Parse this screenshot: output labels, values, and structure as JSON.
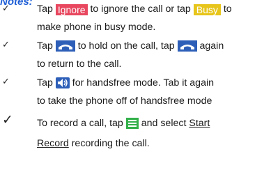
{
  "heading": "Notes:",
  "items": [
    {
      "line1": {
        "pre": "Tap",
        "btn1": "Ignore",
        "mid": "to ignore the call or tap",
        "btn2": "Busy",
        "post": "to"
      },
      "line2": "make phone in busy mode."
    },
    {
      "line1": {
        "pre": "Tap",
        "mid": "to hold on the call, tap",
        "post": "again"
      },
      "line2": "to return to the call.",
      "icon": "hold-icon"
    },
    {
      "line1": {
        "pre": "Tap",
        "post": "for handsfree mode. Tab it again"
      },
      "line2": "to take the phone off of handsfree mode",
      "icon": "speaker-icon"
    },
    {
      "line1": {
        "pre": "To record a call, tap",
        "post": "and select",
        "link": "Start"
      },
      "line2": {
        "link": "Record",
        "post": "recording the call."
      },
      "icon": "menu-icon"
    }
  ],
  "check_glyph": "✓",
  "colors": {
    "heading": "#1f5fd6",
    "ignore": "#e8475f",
    "busy": "#e7c51a",
    "icon_blue": "#2e5fb8",
    "icon_green": "#33b04a"
  }
}
